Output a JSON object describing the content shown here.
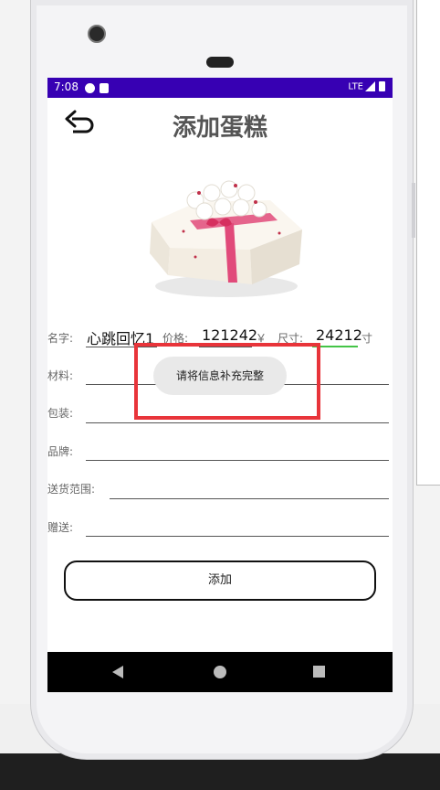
{
  "status": {
    "time": "7:08",
    "network": "LTE"
  },
  "header": {
    "title": "添加蛋糕"
  },
  "form": {
    "name_label": "名字:",
    "name_value": "心跳回忆1",
    "price_label": "价格:",
    "price_value": "121242",
    "price_unit": "￥",
    "size_label": "尺寸:",
    "size_value": "24212",
    "size_unit": "寸",
    "material_label": "材料:",
    "packaging_label": "包装:",
    "brand_label": "品牌:",
    "delivery_label": "送货范围:",
    "gift_label": "赠送:"
  },
  "buttons": {
    "add_label": "添加"
  },
  "toast": {
    "message": "请将信息补充完整"
  },
  "colors": {
    "status_bar": "#3700b3",
    "highlight": "#e8343a",
    "focus_underline": "#44c447"
  },
  "icons": [
    "back-arrow-icon",
    "nav-back-icon",
    "nav-home-icon",
    "nav-recents-icon"
  ]
}
